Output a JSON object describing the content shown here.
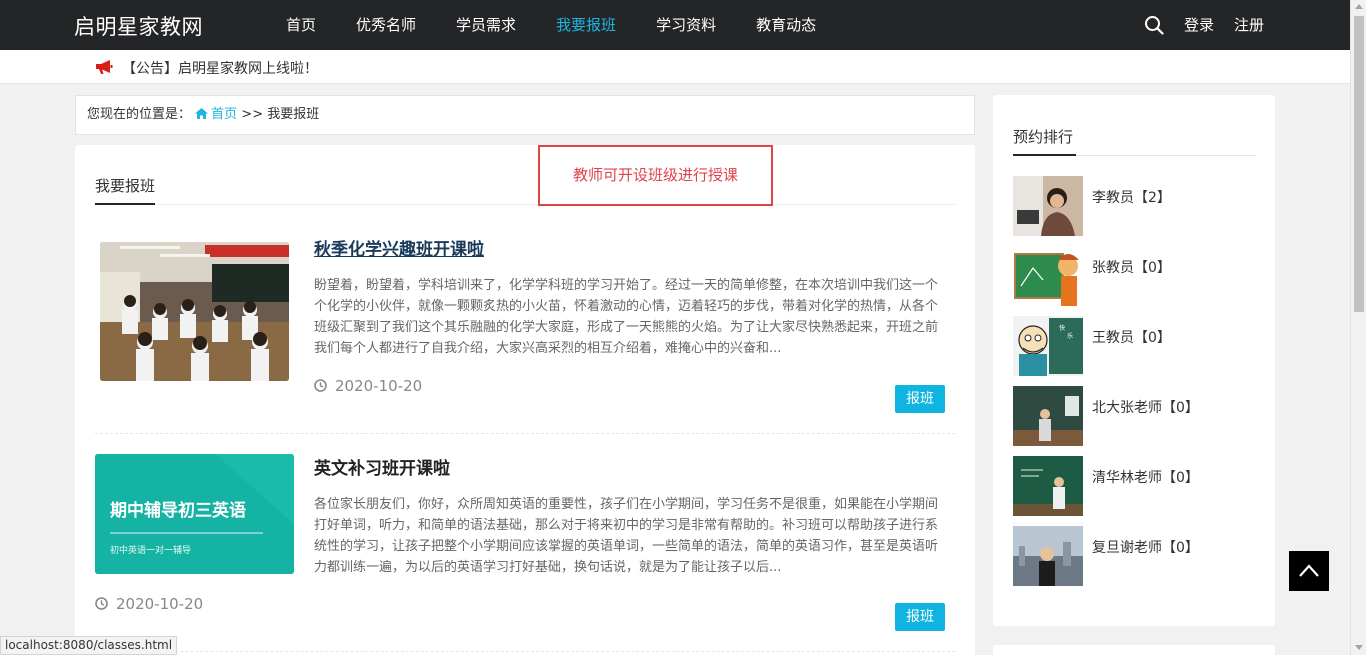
{
  "header": {
    "brand": "启明星家教网",
    "nav": [
      {
        "label": "首页"
      },
      {
        "label": "优秀名师"
      },
      {
        "label": "学员需求"
      },
      {
        "label": "我要报班"
      },
      {
        "label": "学习资料"
      },
      {
        "label": "教育动态"
      }
    ],
    "active_nav": "我要报班",
    "login": "登录",
    "register": "注册",
    "accent_color": "#1fb5e0"
  },
  "notice": {
    "text": "【公告】启明星家教网上线啦！"
  },
  "breadcrumb": {
    "prefix": "您现在的位置是：",
    "home": "首页",
    "separator": " >> ",
    "current": "我要报班"
  },
  "main": {
    "title": "我要报班",
    "annotation": "教师可开设班级进行授课",
    "articles": [
      {
        "title": "秋季化学兴趣班开课啦",
        "desc": "盼望着，盼望着，学科培训来了，化学学科班的学习开始了。经过一天的简单修整，在本次培训中我们这一个个化学的小伙伴，就像一颗颗炙热的小火苗，怀着激动的心情，迈着轻巧的步伐，带着对化学的热情，从各个班级汇聚到了我们这个其乐融融的化学大家庭，形成了一天熊熊的火焰。为了让大家尽快熟悉起来，开班之前我们每个人都进行了自我介绍，大家兴高采烈的相互介绍着，难掩心中的兴奋和...",
        "date": "2020-10-20",
        "button": "报班"
      },
      {
        "title": "英文补习班开课啦",
        "desc": "各位家长朋友们，你好，众所周知英语的重要性，孩子们在小学期间，学习任务不是很重，如果能在小学期间打好单词，听力，和简单的语法基础，那么对于将来初中的学习是非常有帮助的。补习班可以帮助孩子进行系统性的学习，让孩子把整个小学期间应该掌握的英语单词，一些简单的语法，简单的英语习作，甚至是英语听力都训练一遍，为以后的英语学习打好基础，换句话说，就是为了能让孩子以后...",
        "date": "2020-10-20",
        "button": "报班",
        "thumb_title": "期中辅导初三英语",
        "thumb_subtitle": "初中英语一对一辅导"
      }
    ]
  },
  "sidebar": {
    "title": "预约排行",
    "items": [
      {
        "name": "李教员【2】"
      },
      {
        "name": "张教员【0】"
      },
      {
        "name": "王教员【0】"
      },
      {
        "name": "北大张老师【0】"
      },
      {
        "name": "清华林老师【0】"
      },
      {
        "name": "复旦谢老师【0】"
      }
    ]
  },
  "status": {
    "url": "localhost:8080/classes.html"
  }
}
